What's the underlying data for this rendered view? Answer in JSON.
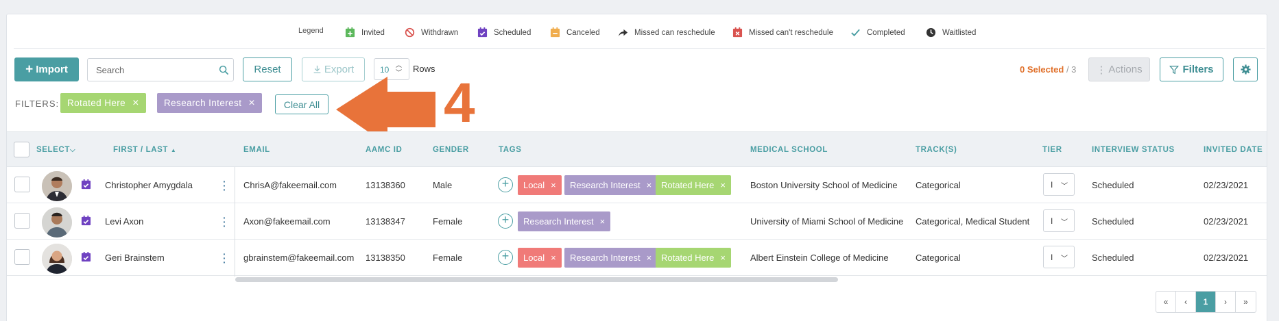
{
  "legend": {
    "title": "Legend",
    "items": [
      {
        "label": "Invited",
        "icon": "calendar-plus-icon",
        "color": "#5cb85c"
      },
      {
        "label": "Withdrawn",
        "icon": "no-symbol-icon",
        "color": "#d9534f"
      },
      {
        "label": "Scheduled",
        "icon": "calendar-check-icon",
        "color": "#6f42c1"
      },
      {
        "label": "Canceled",
        "icon": "calendar-minus-icon",
        "color": "#f0ad4e"
      },
      {
        "label": "Missed can reschedule",
        "icon": "share-arrow-icon",
        "color": "#333333"
      },
      {
        "label": "Missed can't reschedule",
        "icon": "calendar-x-icon",
        "color": "#d9534f"
      },
      {
        "label": "Completed",
        "icon": "checkmark-icon",
        "color": "#4a9ea3"
      },
      {
        "label": "Waitlisted",
        "icon": "clock-icon",
        "color": "#333333"
      }
    ]
  },
  "toolbar": {
    "import_label": "Import",
    "search_placeholder": "Search",
    "reset_label": "Reset",
    "export_label": "Export",
    "rows_value": "10",
    "rows_label": "Rows",
    "selected_count": "0 Selected",
    "selected_total": "/ 3",
    "actions_label": "Actions",
    "filters_label": "Filters"
  },
  "filters": {
    "label": "FILTERS:",
    "chips": [
      "Rotated Here",
      "Research Interest"
    ],
    "clear_label": "Clear All"
  },
  "annotation": {
    "number": "4"
  },
  "table": {
    "headers": {
      "select": "SELECT",
      "name": "FIRST / LAST",
      "email": "EMAIL",
      "aamc": "AAMC ID",
      "gender": "GENDER",
      "tags": "TAGS",
      "school": "MEDICAL SCHOOL",
      "tracks": "TRACK(S)",
      "tier": "TIER",
      "status": "INTERVIEW STATUS",
      "invited": "INVITED DATE"
    },
    "rows": [
      {
        "name": "Christopher Amygdala",
        "email": "ChrisA@fakeemail.com",
        "aamc": "13138360",
        "gender": "Male",
        "tags": [
          "Local",
          "Research Interest",
          "Rotated Here"
        ],
        "school": "Boston University School of Medicine",
        "tracks": "Categorical",
        "tier": "I",
        "status": "Scheduled",
        "invited": "02/23/2021"
      },
      {
        "name": "Levi Axon",
        "email": "Axon@fakeemail.com",
        "aamc": "13138347",
        "gender": "Female",
        "tags": [
          "Research Interest"
        ],
        "school": "University of Miami School of Medicine",
        "tracks": "Categorical, Medical Student",
        "tier": "I",
        "status": "Scheduled",
        "invited": "02/23/2021"
      },
      {
        "name": "Geri Brainstem",
        "email": "gbrainstem@fakeemail.com",
        "aamc": "13138350",
        "gender": "Female",
        "tags": [
          "Local",
          "Research Interest",
          "Rotated Here"
        ],
        "school": "Albert Einstein College of Medicine",
        "tracks": "Categorical",
        "tier": "I",
        "status": "Scheduled",
        "invited": "02/23/2021"
      }
    ]
  },
  "pagination": {
    "first": "«",
    "prev": "‹",
    "current": "1",
    "next": "›",
    "last": "»"
  }
}
